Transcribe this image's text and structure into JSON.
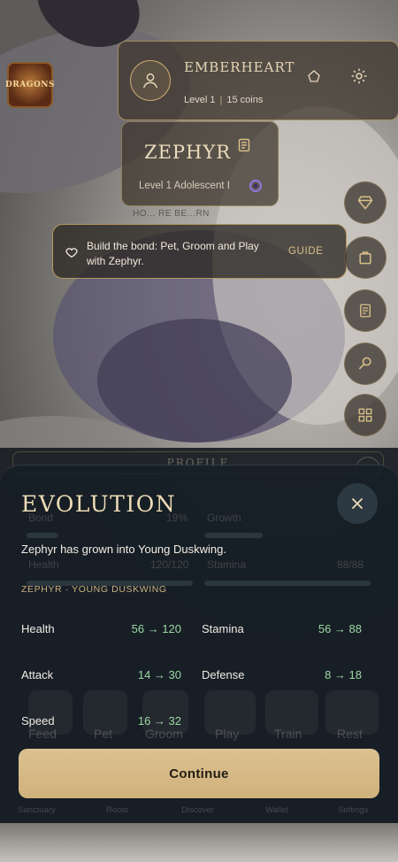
{
  "logo": {
    "text": "DRAGONS"
  },
  "player": {
    "name": "EMBERHEART",
    "level": "Level 1",
    "coins": "15 coins"
  },
  "dragon": {
    "name": "ZEPHYR",
    "meta": "Level 1 Adolescent  I"
  },
  "subtitle_hint": "HO... RE BE...RN",
  "quest": {
    "text": "Build the bond: Pet, Groom and Play with Zephyr.",
    "action": "GUIDE"
  },
  "underlay": {
    "title": "PROFILE",
    "labels": [
      "Bond",
      "19%",
      "Growth",
      "Health",
      "120/120",
      "Stamina",
      "88/88"
    ],
    "actions": [
      "Feed",
      "Pet",
      "Groom",
      "Play",
      "Train",
      "Rest"
    ],
    "nav": [
      "Sanctuary",
      "Roost",
      "Discover",
      "Wallet",
      "Settings"
    ]
  },
  "evolution": {
    "title": "EVOLUTION",
    "message": "Zephyr has grown into Young Duskwing.",
    "subhead": "ZEPHYR · YOUNG DUSKWING",
    "stats": [
      {
        "label": "Health",
        "value": "56 → 120"
      },
      {
        "label": "Stamina",
        "value": "56 → 88"
      },
      {
        "label": "Attack",
        "value": "14 → 30"
      },
      {
        "label": "Defense",
        "value": "8 → 18"
      },
      {
        "label": "Speed",
        "value": "16 → 32"
      }
    ],
    "continue_label": "Continue"
  },
  "colors": {
    "accent_gold": "#cfb17c",
    "stat_green": "#9bd8a3",
    "sheet_bg": "#161e26"
  }
}
